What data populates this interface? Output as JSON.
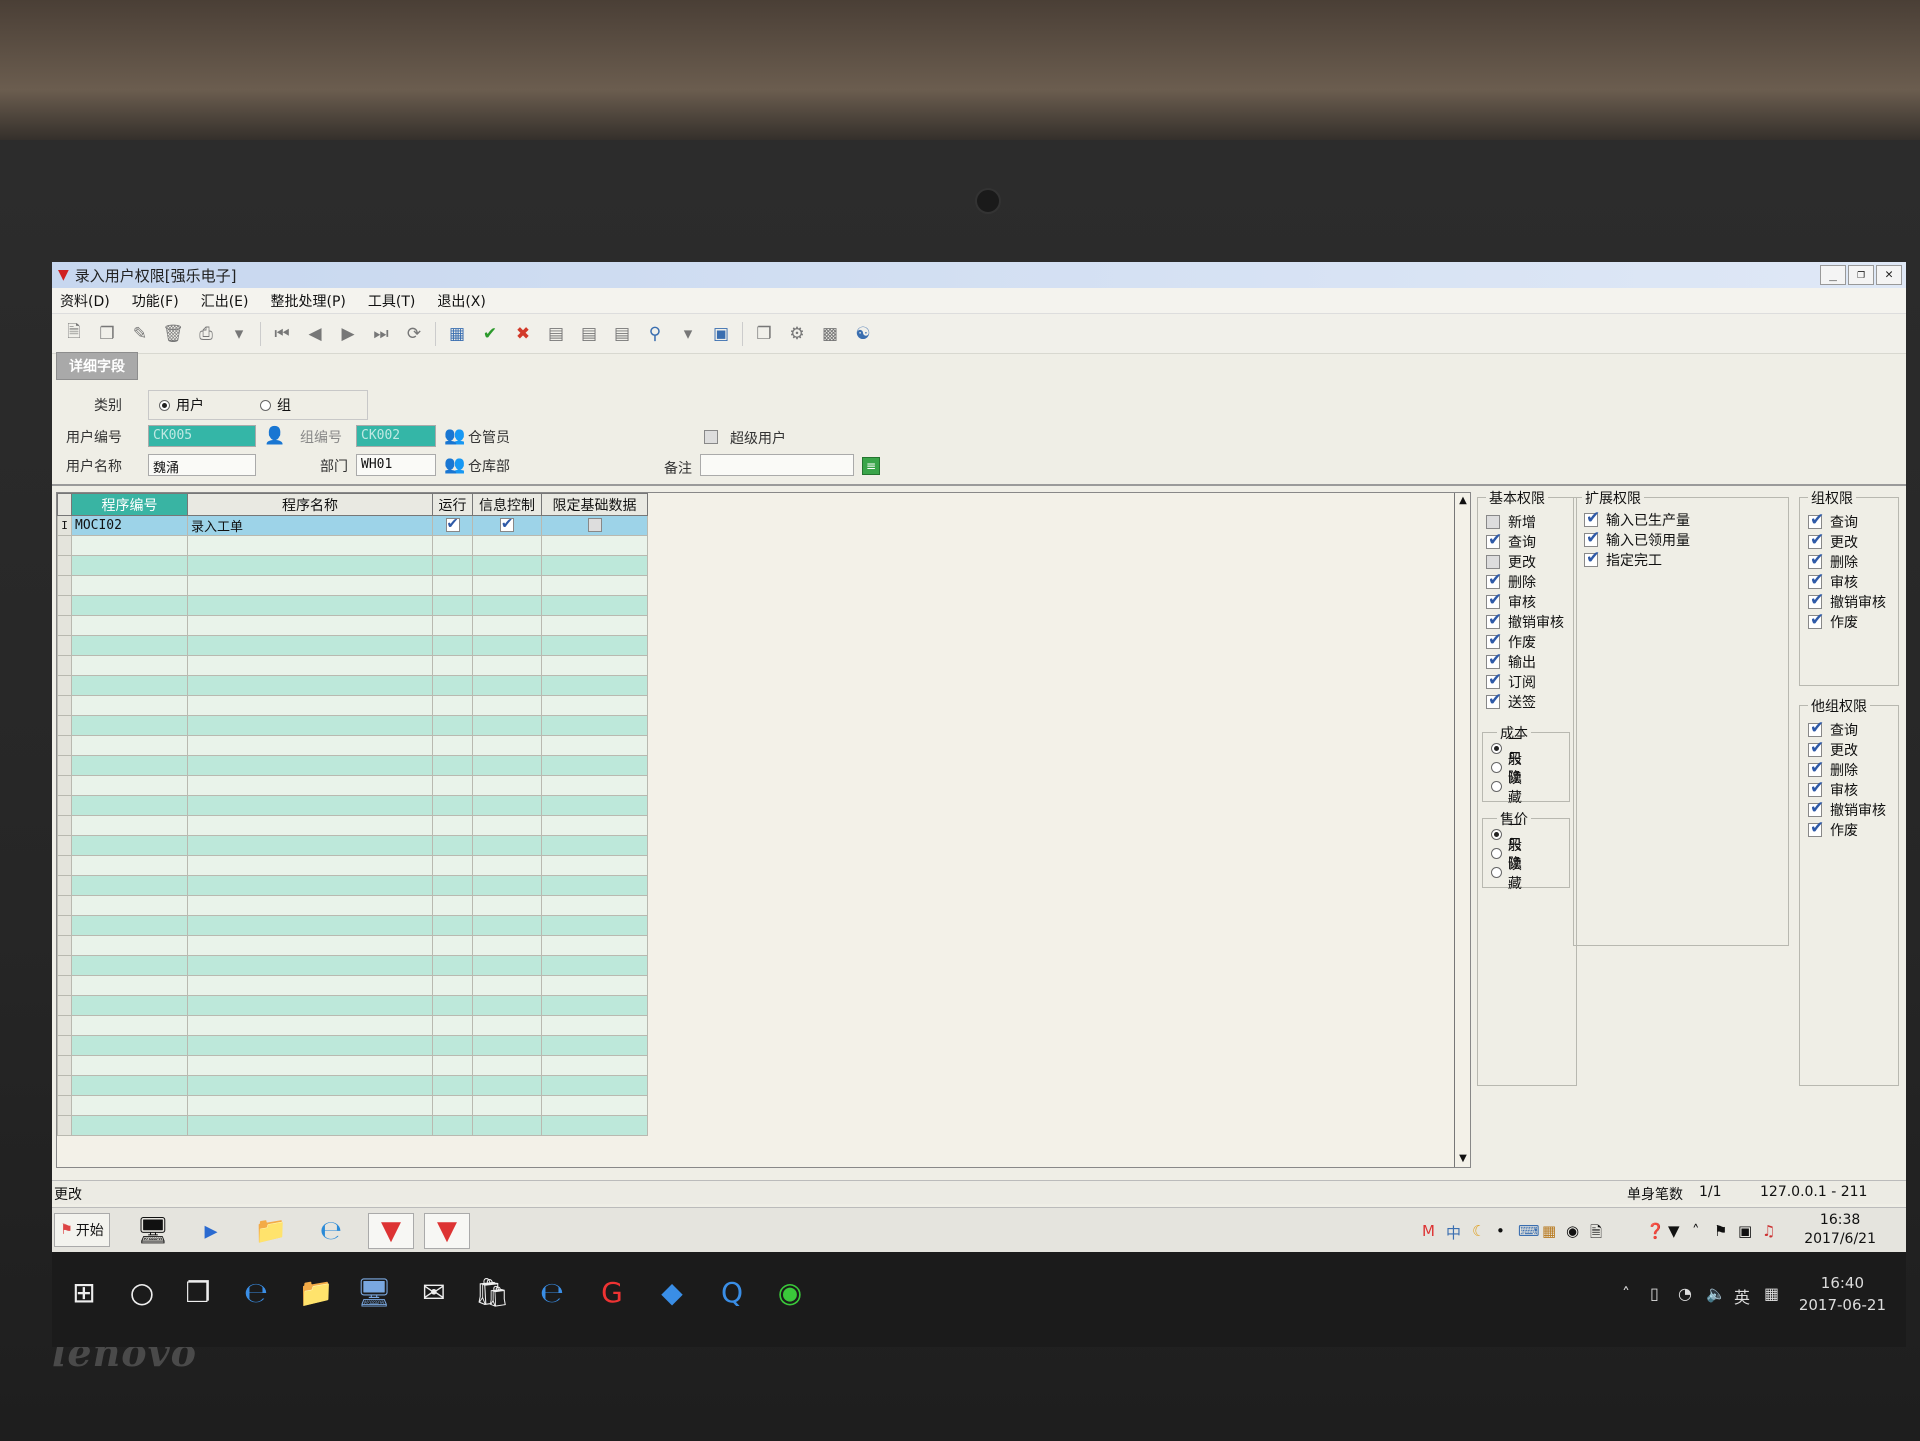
{
  "window": {
    "title": "录入用户权限[强乐电子]"
  },
  "menu": [
    "资料(D)",
    "功能(F)",
    "汇出(E)",
    "整批处理(P)",
    "工具(T)",
    "退出(X)"
  ],
  "tab": "详细字段",
  "form": {
    "type_label": "类别",
    "type_user": "用户",
    "type_group": "组",
    "user_id_label": "用户编号",
    "user_id": "CK005",
    "group_id_label": "组编号",
    "group_id": "CK002",
    "group_name": "仓管员",
    "super_user_label": "超级用户",
    "user_name_label": "用户名称",
    "user_name": "魏涌",
    "dept_label": "部门",
    "dept_id": "WH01",
    "dept_name": "仓库部",
    "remark_label": "备注",
    "remark": ""
  },
  "grid": {
    "columns": [
      "程序编号",
      "程序名称",
      "运行",
      "信息控制",
      "限定基础数据"
    ],
    "rows": [
      {
        "indicator": "I",
        "code": "MOCI02",
        "name": "录入工单",
        "run": true,
        "info": true,
        "limit": false
      }
    ]
  },
  "basic_perm": {
    "title": "基本权限",
    "items": [
      {
        "label": "新增",
        "checked": false
      },
      {
        "label": "查询",
        "checked": true
      },
      {
        "label": "更改",
        "checked": false
      },
      {
        "label": "删除",
        "checked": true
      },
      {
        "label": "审核",
        "checked": true
      },
      {
        "label": "撤销审核",
        "checked": true
      },
      {
        "label": "作废",
        "checked": true
      },
      {
        "label": "输出",
        "checked": true
      },
      {
        "label": "订阅",
        "checked": true
      },
      {
        "label": "送签",
        "checked": true
      }
    ],
    "cost": {
      "title": "成本",
      "options": [
        "一 般",
        "只 读",
        "隐 藏"
      ],
      "selected": 0
    },
    "price": {
      "title": "售价",
      "options": [
        "一 般",
        "只 读",
        "隐 藏"
      ],
      "selected": 0
    }
  },
  "ext_perm": {
    "title": "扩展权限",
    "items": [
      {
        "label": "输入已生产量",
        "checked": true
      },
      {
        "label": "输入已领用量",
        "checked": true
      },
      {
        "label": "指定完工",
        "checked": true
      }
    ]
  },
  "group_perm": {
    "title": "组权限",
    "items": [
      {
        "label": "查询",
        "checked": true
      },
      {
        "label": "更改",
        "checked": true
      },
      {
        "label": "删除",
        "checked": true
      },
      {
        "label": "审核",
        "checked": true
      },
      {
        "label": "撤销审核",
        "checked": true
      },
      {
        "label": "作废",
        "checked": true
      }
    ]
  },
  "other_group_perm": {
    "title": "他组权限",
    "items": [
      {
        "label": "查询",
        "checked": true
      },
      {
        "label": "更改",
        "checked": true
      },
      {
        "label": "删除",
        "checked": true
      },
      {
        "label": "审核",
        "checked": true
      },
      {
        "label": "撤销审核",
        "checked": true
      },
      {
        "label": "作废",
        "checked": true
      }
    ]
  },
  "status": {
    "mode": "更改",
    "label": "单身笔数",
    "count": "1/1",
    "ip": "127.0.0.1 - 211"
  },
  "xp_taskbar": {
    "start": "开始",
    "time": "16:38",
    "date": "2017/6/21"
  },
  "win_taskbar": {
    "ime": "英",
    "time": "16:40",
    "date": "2017-06-21"
  },
  "brand": "lenovo"
}
